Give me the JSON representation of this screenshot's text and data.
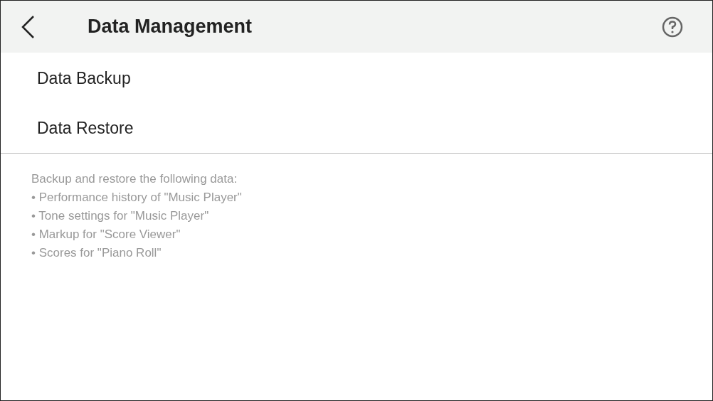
{
  "header": {
    "title": "Data Management"
  },
  "menu_items": [
    {
      "label": "Data Backup"
    },
    {
      "label": "Data Restore"
    }
  ],
  "description": {
    "heading": "Backup and restore the following data:",
    "lines": [
      "• Performance history of \"Music Player\"",
      "• Tone settings for \"Music Player\"",
      "• Markup for \"Score Viewer\"",
      "• Scores for \"Piano Roll\""
    ]
  }
}
